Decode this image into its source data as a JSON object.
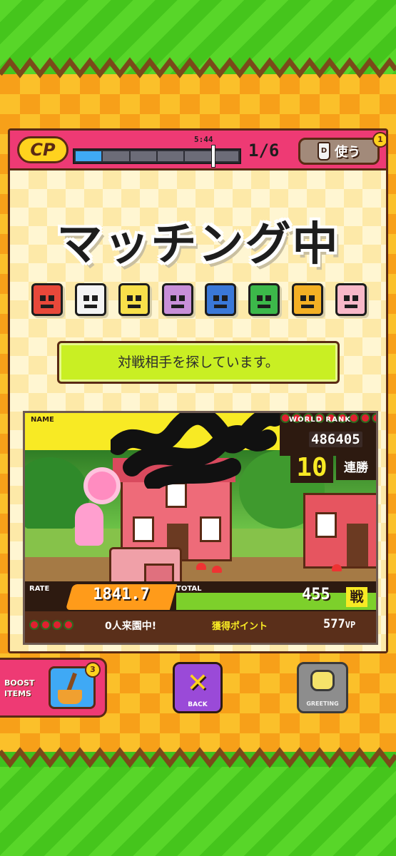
{
  "cp": {
    "logo": "CP",
    "timer": "5:44",
    "count": "1/6",
    "gauge_fraction": 0.82,
    "use_button": "使う",
    "use_badge": "1",
    "bottle_letter": "D"
  },
  "title": "マッチング中",
  "characters": [
    {
      "icon": "red-robot-icon",
      "color": "#e8483a"
    },
    {
      "icon": "panda-icon",
      "color": "#f4f4f4"
    },
    {
      "icon": "yellow-giraffe-icon",
      "color": "#f8e04a"
    },
    {
      "icon": "purple-castle-icon",
      "color": "#c88fd8"
    },
    {
      "icon": "blue-penguin-icon",
      "color": "#3a78d8"
    },
    {
      "icon": "green-frog-icon",
      "color": "#3cb84a"
    },
    {
      "icon": "gold-coin-icon",
      "color": "#f4b024"
    },
    {
      "icon": "pink-rabbit-icon",
      "color": "#f8b8c8"
    }
  ],
  "message": "対戦相手を探しています。",
  "player": {
    "name_label": "NAME",
    "world_rank_label": "WORLD RANK",
    "world_rank": "486405",
    "streak": "10",
    "streak_label": "連勝",
    "rate_label": "RATE",
    "rate": "1841.7",
    "total_label": "TOTAL",
    "total": "455",
    "total_unit": "戦",
    "visitors": "0人来園中!",
    "points_label": "獲得ポイント",
    "points": "577",
    "points_unit": "VP"
  },
  "buttons": {
    "boost_label_1": "BOOST",
    "boost_label_2": "ITEMS",
    "boost_badge": "3",
    "back_label": "BACK",
    "back_symbol": "✕",
    "greeting_label": "GREETING"
  }
}
